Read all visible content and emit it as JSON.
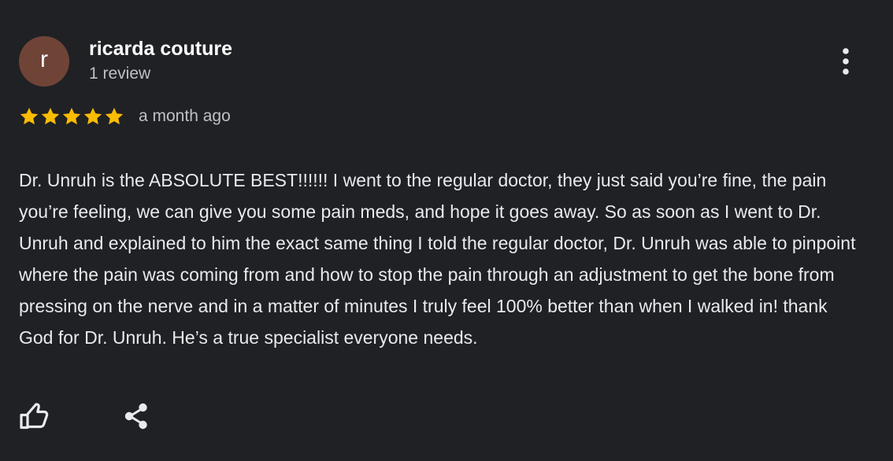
{
  "review": {
    "author": {
      "avatar_initial": "r",
      "avatar_color": "#6f4437",
      "name": "ricarda couture",
      "review_count": "1 review"
    },
    "more_icon": "three-dots-vertical-icon",
    "rating": {
      "stars": 5,
      "max_stars": 5,
      "star_color": "#fbbc04"
    },
    "time_ago": "a month ago",
    "text": "Dr. Unruh is the ABSOLUTE BEST!!!!!! I went to the regular doctor, they just said you’re fine, the pain you’re feeling, we can give you some pain meds, and hope it goes away. So as soon as I went to Dr. Unruh and explained to him the exact same thing I told the regular doctor, Dr. Unruh was able to pinpoint where the pain was coming from and how to stop the pain through an adjustment to get the bone from pressing on the nerve and in a matter of minutes I truly feel 100% better than when I walked in! thank God for Dr. Unruh. He’s a true specialist everyone needs.",
    "actions": {
      "like_icon": "thumbs-up-icon",
      "share_icon": "share-icon"
    }
  },
  "colors": {
    "background": "#202124",
    "primary_text": "#e8eaed",
    "secondary_text": "#bdc1c6",
    "icon": "#e8eaed"
  }
}
